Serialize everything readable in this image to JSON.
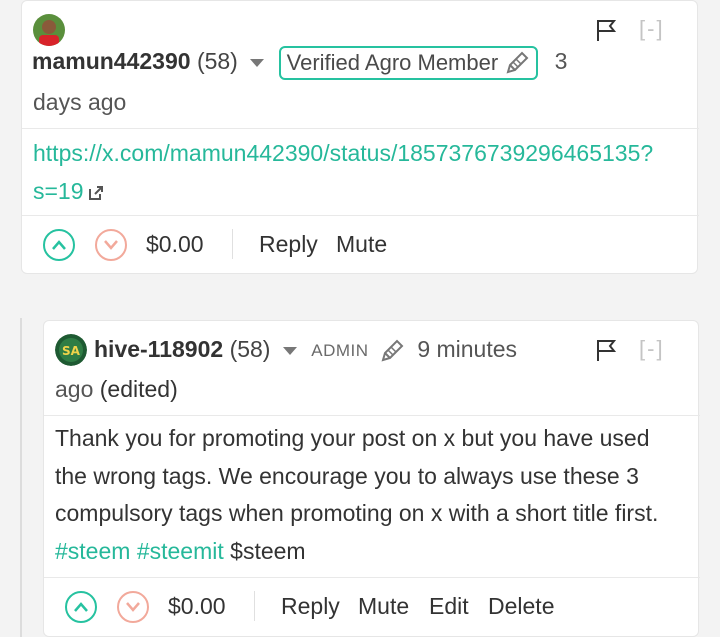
{
  "comment1": {
    "author": "mamun442390",
    "reputation": "(58)",
    "badge": "Verified Agro Member",
    "time_part1": "3",
    "time_part2": "days ago",
    "link_line1": "https://x.com/mamun442390/status/1857376739296465135?",
    "link_line2": "s=19",
    "payout": "$0.00",
    "actions": [
      "Reply",
      "Mute"
    ],
    "collapse": "[-]"
  },
  "comment2": {
    "author": "hive-118902",
    "reputation": "(58)",
    "role": "ADMIN",
    "time_part1": "9 minutes",
    "time_part2": "ago",
    "edited": "(edited)",
    "body_line1": "Thank you for promoting your post on x but you have used",
    "body_line2": "the wrong tags. We encourage you to always use these 3",
    "body_line3": "compulsory tags when promoting on x with a short title first.",
    "tags": [
      "#steem",
      "#steemit"
    ],
    "dollar_tag": "$steem",
    "payout": "$0.00",
    "actions": [
      "Reply",
      "Mute",
      "Edit",
      "Delete"
    ],
    "collapse": "[-]"
  },
  "colors": {
    "accent": "#26c2a0",
    "link": "#26b89a",
    "downvote": "#f2a99b",
    "divider": "#e9e9e9"
  },
  "icons": [
    "flag-icon",
    "pencil-icon",
    "external-link-icon",
    "upvote-icon",
    "downvote-icon",
    "caret-down-icon"
  ]
}
